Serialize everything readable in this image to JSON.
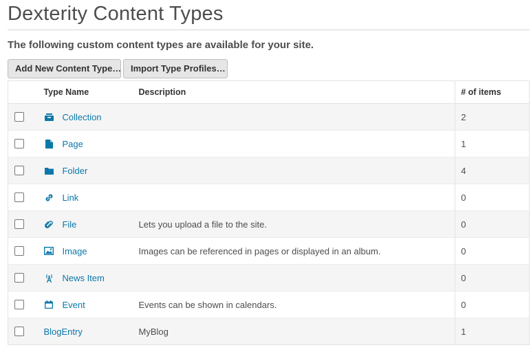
{
  "page": {
    "title": "Dexterity Content Types",
    "subtitle": "The following custom content types are available for your site."
  },
  "toolbar": {
    "add_label": "Add New Content Type…",
    "import_label": "Import Type Profiles…"
  },
  "table": {
    "headers": {
      "name": "Type Name",
      "description": "Description",
      "count": "# of items"
    },
    "rows": [
      {
        "name": "Collection",
        "icon": "collection-icon",
        "description": "",
        "count": "2"
      },
      {
        "name": "Page",
        "icon": "page-icon",
        "description": "",
        "count": "1"
      },
      {
        "name": "Folder",
        "icon": "folder-icon",
        "description": "",
        "count": "4"
      },
      {
        "name": "Link",
        "icon": "link-icon",
        "description": "",
        "count": "0"
      },
      {
        "name": "File",
        "icon": "paperclip-icon",
        "description": "Lets you upload a file to the site.",
        "count": "0"
      },
      {
        "name": "Image",
        "icon": "image-icon",
        "description": "Images can be referenced in pages or displayed in an album.",
        "count": "0"
      },
      {
        "name": "News Item",
        "icon": "broadcast-icon",
        "description": "",
        "count": "0"
      },
      {
        "name": "Event",
        "icon": "calendar-icon",
        "description": "Events can be shown in calendars.",
        "count": "0"
      },
      {
        "name": "BlogEntry",
        "icon": "",
        "description": "MyBlog",
        "count": "1"
      }
    ]
  },
  "colors": {
    "link": "#0b78a8",
    "text": "#4d4d4d",
    "row_alt": "#f5f5f5",
    "button_bg": "#e6e6e6"
  }
}
